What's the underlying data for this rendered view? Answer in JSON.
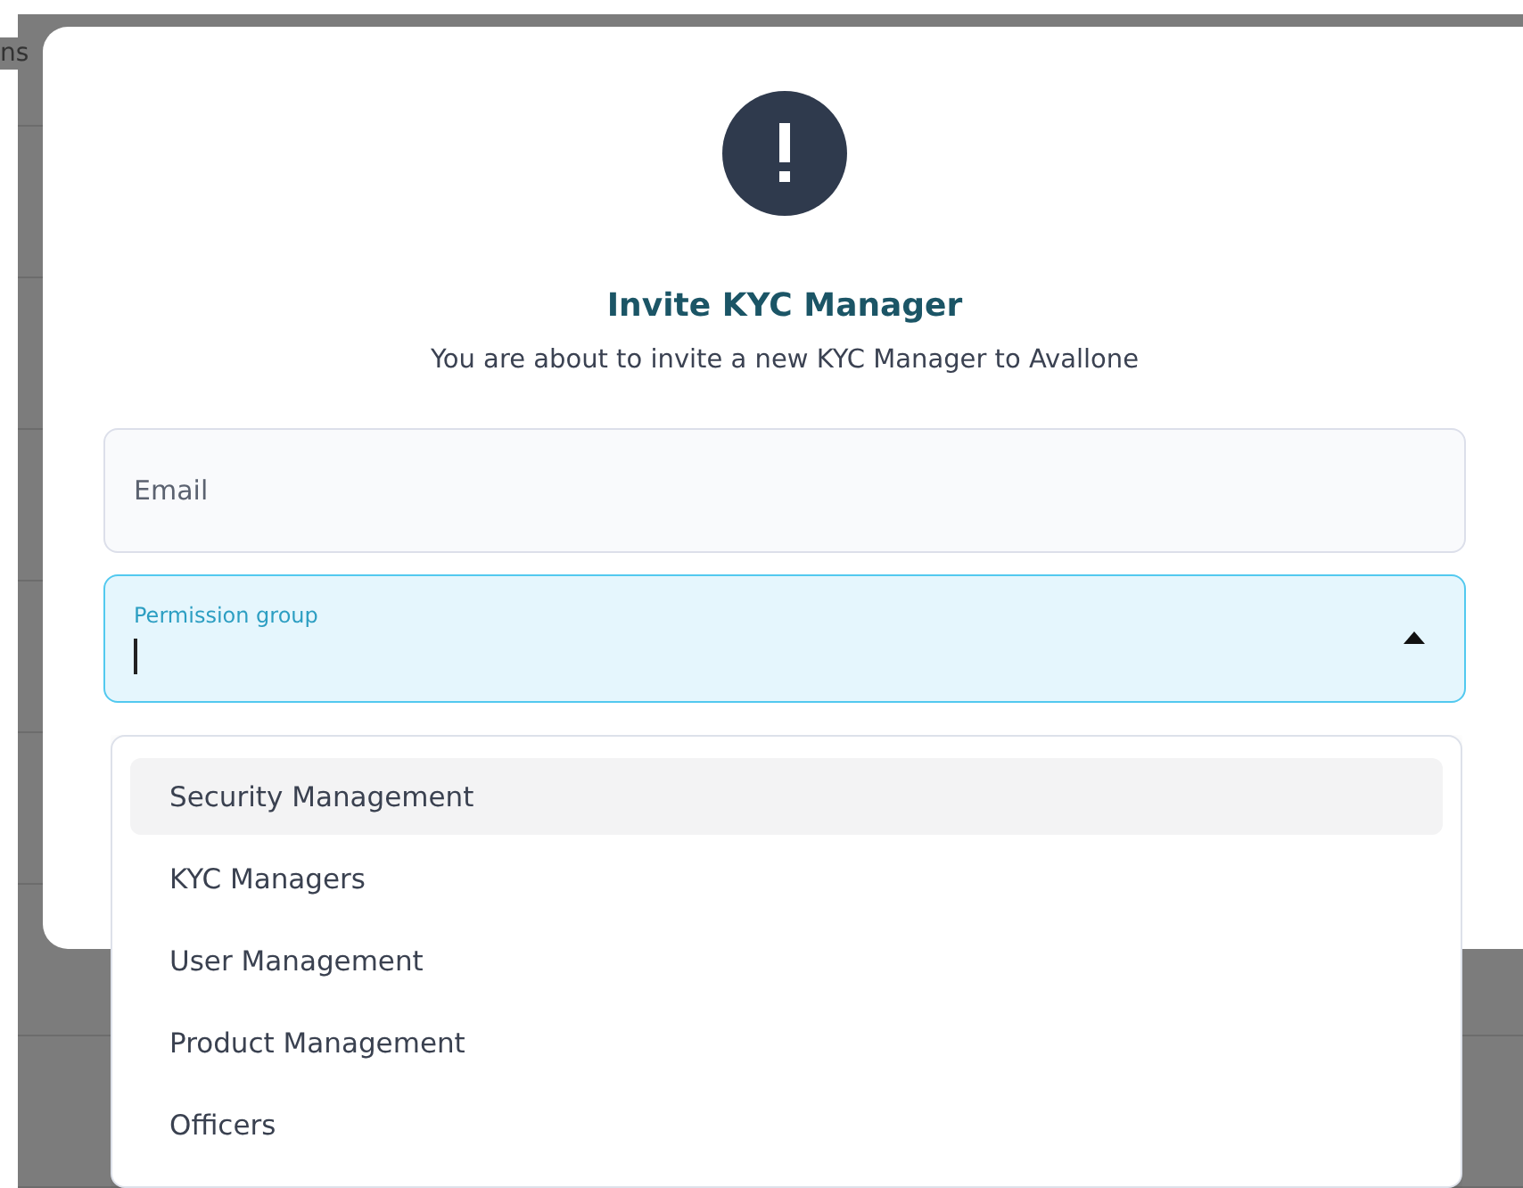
{
  "background": {
    "cut_text": "ns"
  },
  "dialog": {
    "title": "Invite KYC Manager",
    "subtitle": "You are about to invite a new KYC Manager to Avallone"
  },
  "fields": [
    {
      "kind": "text",
      "placeholder": "Email",
      "focused": false
    },
    {
      "kind": "select",
      "label": "Permission group",
      "focused": true,
      "expanded": true
    }
  ],
  "options": [
    {
      "label": "Security Management",
      "selected": true
    },
    {
      "label": "KYC Managers",
      "selected": false
    },
    {
      "label": "User Management",
      "selected": false
    },
    {
      "label": "Product Management",
      "selected": false
    },
    {
      "label": "Officers",
      "selected": false
    }
  ]
}
